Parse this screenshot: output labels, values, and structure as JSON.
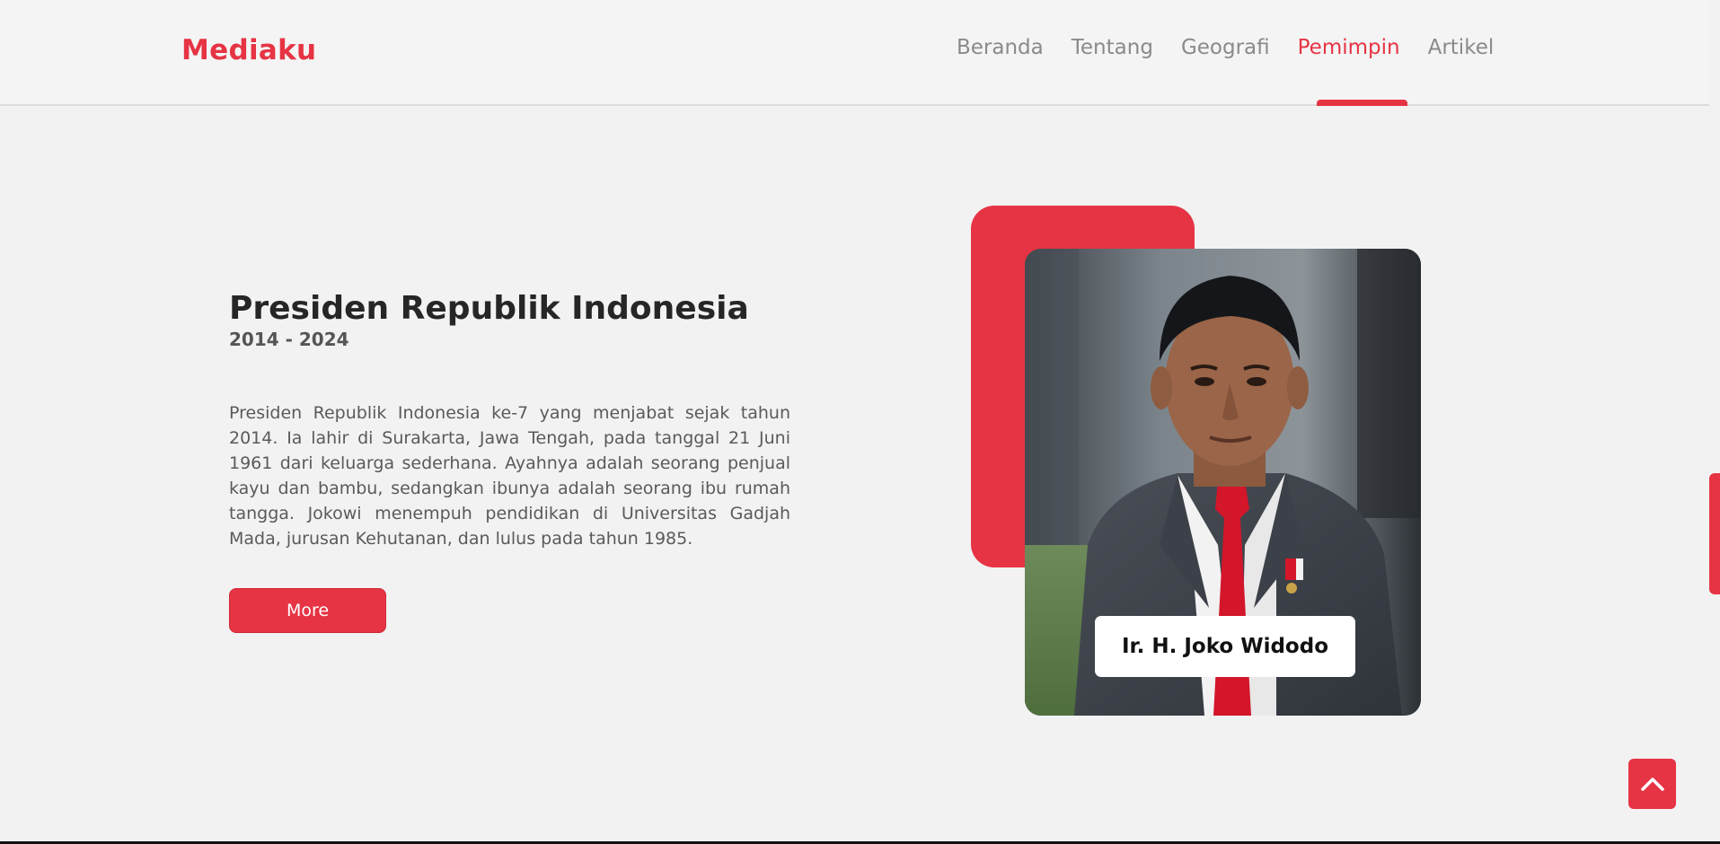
{
  "brand": {
    "name": "Mediaku"
  },
  "nav": {
    "items": [
      {
        "label": "Beranda"
      },
      {
        "label": "Tentang"
      },
      {
        "label": "Geografi"
      },
      {
        "label": "Pemimpin",
        "active": true
      },
      {
        "label": "Artikel"
      }
    ]
  },
  "hero": {
    "title": "Presiden Republik Indonesia",
    "years": "2014 - 2024",
    "description": "Presiden Republik Indonesia ke-7 yang menjabat sejak tahun 2014. Ia lahir di Surakarta, Jawa Tengah, pada tanggal 21 Juni 1961 dari keluarga sederhana. Ayahnya adalah seorang penjual kayu dan bambu, sedangkan ibunya adalah seorang ibu rumah tangga. Jokowi menempuh pendidikan di Universitas Gadjah Mada, jurusan Kehutanan, dan lulus pada tahun 1985.",
    "more_label": "More"
  },
  "portrait": {
    "name": "Ir. H. Joko Widodo"
  },
  "icons": {
    "back_to_top": "chevron-up-icon"
  },
  "colors": {
    "accent": "#e63444",
    "background": "#f2f2f2"
  }
}
